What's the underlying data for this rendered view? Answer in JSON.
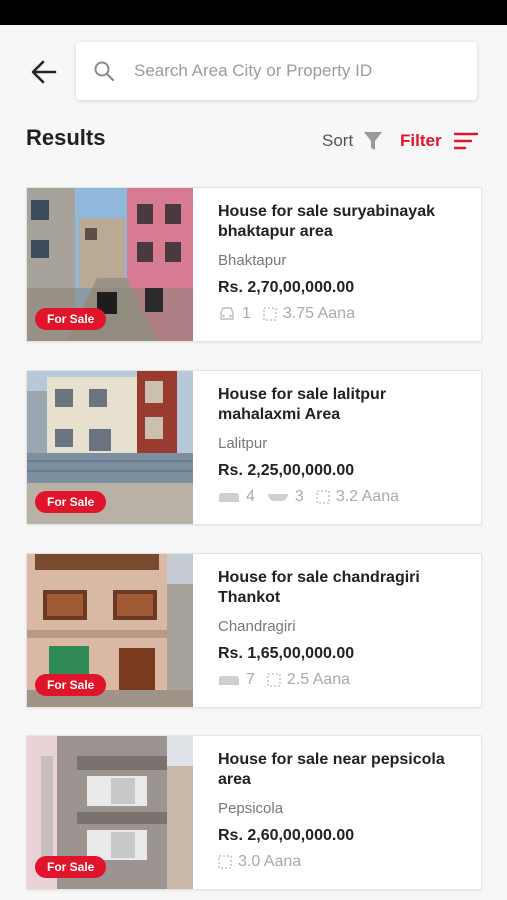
{
  "search": {
    "placeholder": "Search Area City or Property ID"
  },
  "header": {
    "title": "Results",
    "sort_label": "Sort",
    "filter_label": "Filter"
  },
  "colors": {
    "accent": "#e0142a",
    "background": "#f7f7f7"
  },
  "listings": [
    {
      "title": "House for sale suryabinayak bhaktapur area",
      "location": "Bhaktapur",
      "price": "Rs.  2,70,00,000.00",
      "badge": "For Sale",
      "parking": "1",
      "area": "3.75 Aana"
    },
    {
      "title": "House for sale lalitpur mahalaxmi Area",
      "location": "Lalitpur",
      "price": "Rs.  2,25,00,000.00",
      "badge": "For Sale",
      "bedrooms": "4",
      "bathrooms": "3",
      "area": "3.2 Aana"
    },
    {
      "title": "House for sale chandragiri Thankot",
      "location": "Chandragiri",
      "price": "Rs.  1,65,00,000.00",
      "badge": "For Sale",
      "bedrooms": "7",
      "area": "2.5 Aana"
    },
    {
      "title": "House for sale near pepsicola area",
      "location": "Pepsicola",
      "price": "Rs.  2,60,00,000.00",
      "badge": "For Sale",
      "area": "3.0 Aana"
    }
  ]
}
